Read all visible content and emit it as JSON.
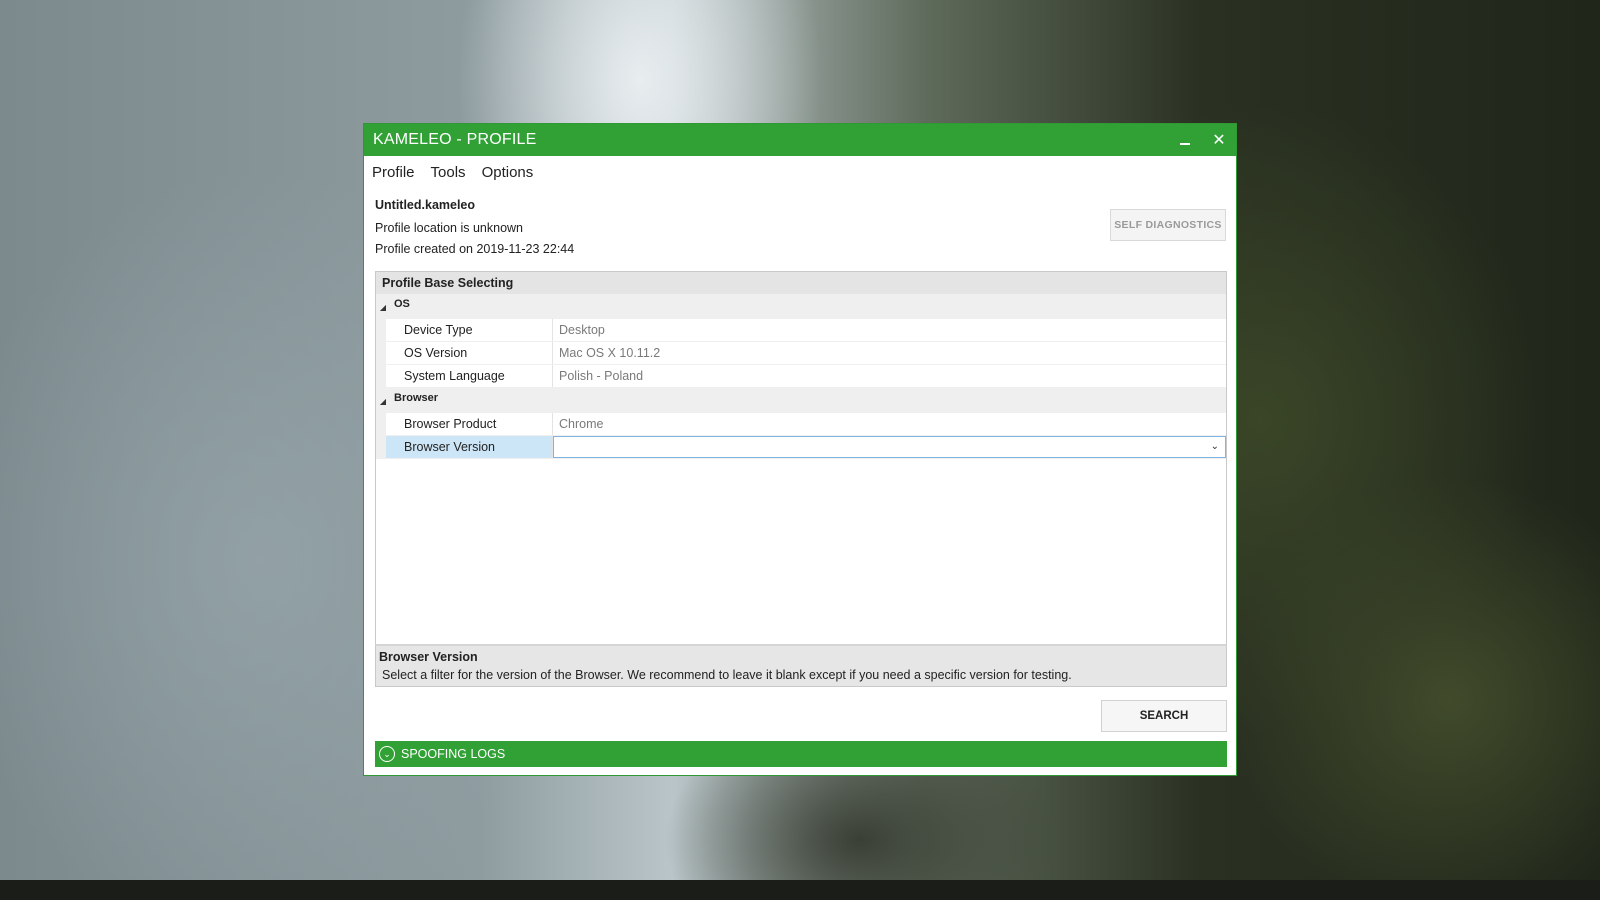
{
  "window": {
    "title": "KAMELEO - PROFILE",
    "accent_color": "#31a136"
  },
  "menu": {
    "items": [
      "Profile",
      "Tools",
      "Options"
    ]
  },
  "profile": {
    "filename": "Untitled.kameleo",
    "location": "Profile location is unknown",
    "created": "Profile created on 2019-11-23 22:44",
    "self_diagnostics_label": "SELF DIAGNOSTICS"
  },
  "panel": {
    "title": "Profile Base Selecting",
    "groups": [
      {
        "label": "OS",
        "rows": [
          {
            "key": "Device Type",
            "value": "Desktop"
          },
          {
            "key": "OS Version",
            "value": "Mac OS X 10.11.2"
          },
          {
            "key": "System Language",
            "value": "Polish - Poland"
          }
        ]
      },
      {
        "label": "Browser",
        "rows": [
          {
            "key": "Browser Product",
            "value": "Chrome"
          },
          {
            "key": "Browser Version",
            "value": ""
          }
        ]
      }
    ]
  },
  "description": {
    "title": "Browser Version",
    "text": "Select a filter for the version of the Browser. We recommend to leave it blank except if you need a specific version for testing."
  },
  "search_label": "SEARCH",
  "logs_label": "SPOOFING LOGS",
  "icons": {
    "minimize": "minimize-icon",
    "close": "close-icon",
    "collapse": "collapse-triangle-icon",
    "dropdown": "chevron-down-icon",
    "expand_logs": "circle-chevron-down-icon"
  }
}
